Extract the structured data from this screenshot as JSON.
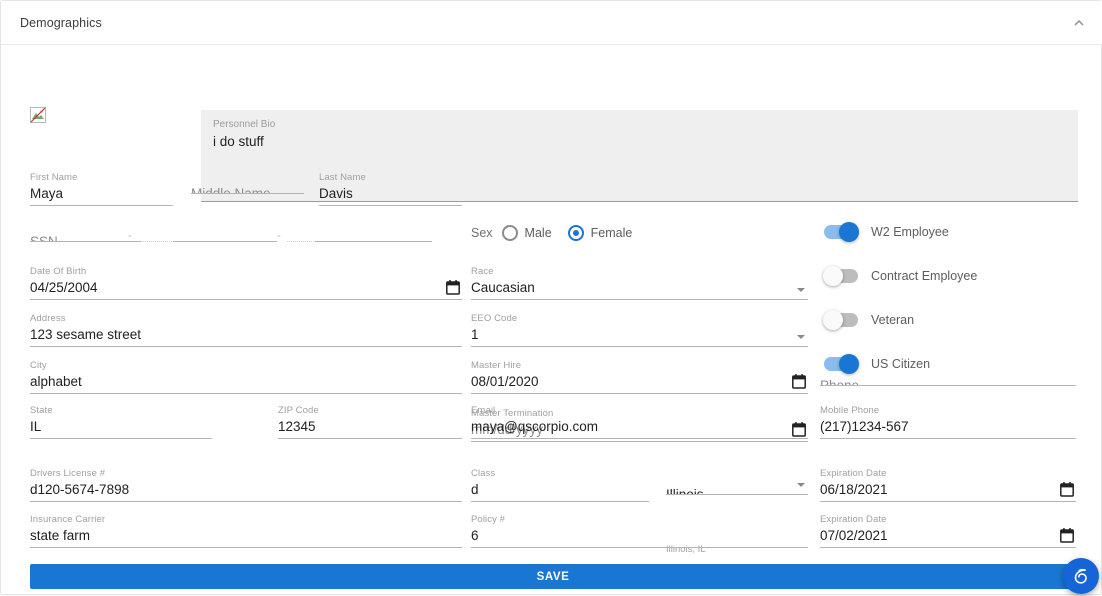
{
  "panel": {
    "title": "Demographics",
    "collapse_icon": "chevron-up-icon",
    "avatar": "broken-image-icon"
  },
  "colors": {
    "accent": "#1976d2",
    "toggle_on_track": "#8cbced",
    "toggle_off_track": "#bdbdbd",
    "label": "#a0a0a0",
    "value": "#212121",
    "textarea_fill": "#efefef",
    "fab": "#1565d8"
  },
  "bio": {
    "label": "Personnel Bio",
    "value": "i do stuff"
  },
  "fields": {
    "first_name": {
      "label": "First Name",
      "value": "Maya"
    },
    "middle_name": {
      "label": "",
      "placeholder": "Middle Name",
      "value": ""
    },
    "last_name": {
      "label": "Last Name",
      "value": "Davis"
    },
    "ssn": {
      "label": "",
      "placeholder": "SSN",
      "value": "",
      "part2": "",
      "part3": "",
      "separator": "-"
    },
    "date_of_birth": {
      "label": "Date Of Birth",
      "value": "04/25/2004",
      "icon": "calendar-icon"
    },
    "address": {
      "label": "Address",
      "value": "123 sesame street"
    },
    "city": {
      "label": "City",
      "value": "alphabet"
    },
    "state": {
      "label": "State",
      "value": "IL"
    },
    "zip_code": {
      "label": "ZIP Code",
      "value": "12345"
    },
    "drivers_license": {
      "label": "Drivers License #",
      "value": "d120-5674-7898"
    },
    "insurance_carrier": {
      "label": "Insurance Carrier",
      "value": "state farm"
    },
    "race": {
      "label": "Race",
      "value": "Caucasian",
      "icon": "chevron-down-icon"
    },
    "eeo_code": {
      "label": "EEO Code",
      "value": "1",
      "icon": "chevron-down-icon"
    },
    "master_hire": {
      "label": "Master Hire",
      "value": "08/01/2020",
      "icon": "calendar-icon"
    },
    "master_termination": {
      "label": "Master Termination",
      "value": "mm/dd/yyyy",
      "icon": "calendar-icon"
    },
    "email": {
      "label": "Email",
      "value": "maya@qscorpio.com"
    },
    "class": {
      "label": "Class",
      "value": "d"
    },
    "policy_number": {
      "label": "Policy #",
      "value": "6"
    },
    "license_state": {
      "label": "",
      "value": "Illinois",
      "hint": "Illinois, IL",
      "icon": "chevron-down-icon"
    },
    "phone": {
      "label": "",
      "placeholder": "Phone",
      "value": ""
    },
    "mobile_phone": {
      "label": "Mobile Phone",
      "value": "(217)1234-567"
    },
    "license_expiration": {
      "label": "Expiration Date",
      "value": "06/18/2021",
      "icon": "calendar-icon"
    },
    "insurance_expiration": {
      "label": "Expiration Date",
      "value": "07/02/2021",
      "icon": "calendar-icon"
    }
  },
  "sex": {
    "label": "Sex",
    "options": [
      {
        "label": "Male",
        "selected": false
      },
      {
        "label": "Female",
        "selected": true
      }
    ]
  },
  "toggles": [
    {
      "label": "W2 Employee",
      "on": true
    },
    {
      "label": "Contract Employee",
      "on": false
    },
    {
      "label": "Veteran",
      "on": false
    },
    {
      "label": "US Citizen",
      "on": true
    }
  ],
  "actions": {
    "save_label": "SAVE",
    "fab_icon": "support-swirl-icon"
  }
}
